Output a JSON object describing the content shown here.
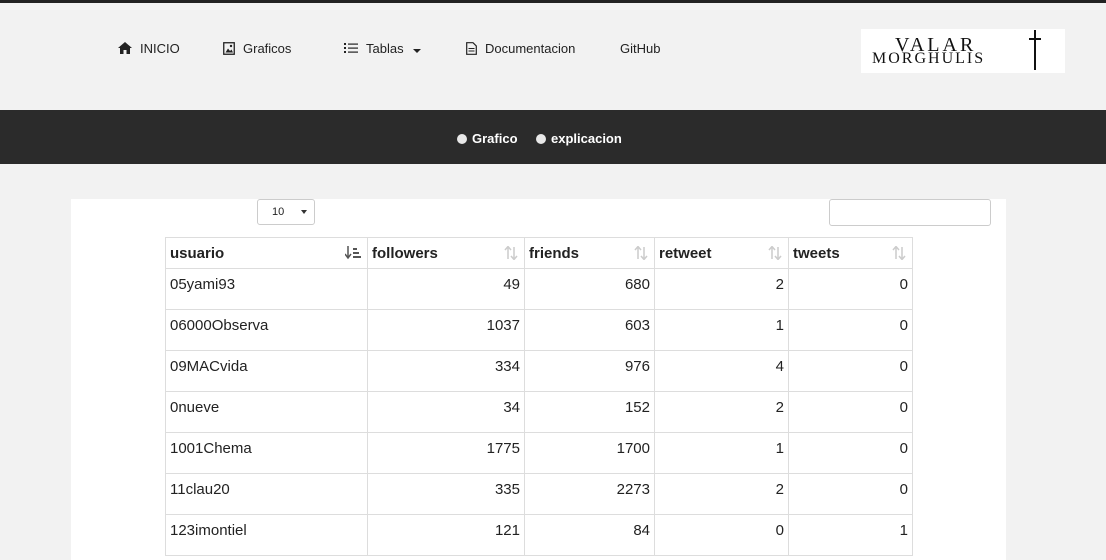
{
  "nav": {
    "items": [
      {
        "label": "INICIO",
        "icon": "home-icon"
      },
      {
        "label": "Graficos",
        "icon": "image-icon"
      },
      {
        "label": "Tablas",
        "icon": "list-icon"
      },
      {
        "label": "Documentacion",
        "icon": "document-icon"
      },
      {
        "label": "GitHub"
      }
    ],
    "logo": {
      "line1": "VALAR",
      "line2": "MORGHULIS"
    }
  },
  "toggle": {
    "options": [
      "Grafico",
      "explicacion"
    ]
  },
  "table_controls": {
    "page_length": "10",
    "search_value": ""
  },
  "table": {
    "columns": [
      "usuario",
      "followers",
      "friends",
      "retweet",
      "tweets"
    ],
    "rows": [
      [
        "05yami93",
        "49",
        "680",
        "2",
        "0"
      ],
      [
        "06000Observa",
        "1037",
        "603",
        "1",
        "0"
      ],
      [
        "09MACvida",
        "334",
        "976",
        "4",
        "0"
      ],
      [
        "0nueve",
        "34",
        "152",
        "2",
        "0"
      ],
      [
        "1001Chema",
        "1775",
        "1700",
        "1",
        "0"
      ],
      [
        "11clau20",
        "335",
        "2273",
        "2",
        "0"
      ],
      [
        "123imontiel",
        "121",
        "84",
        "0",
        "1"
      ]
    ]
  }
}
